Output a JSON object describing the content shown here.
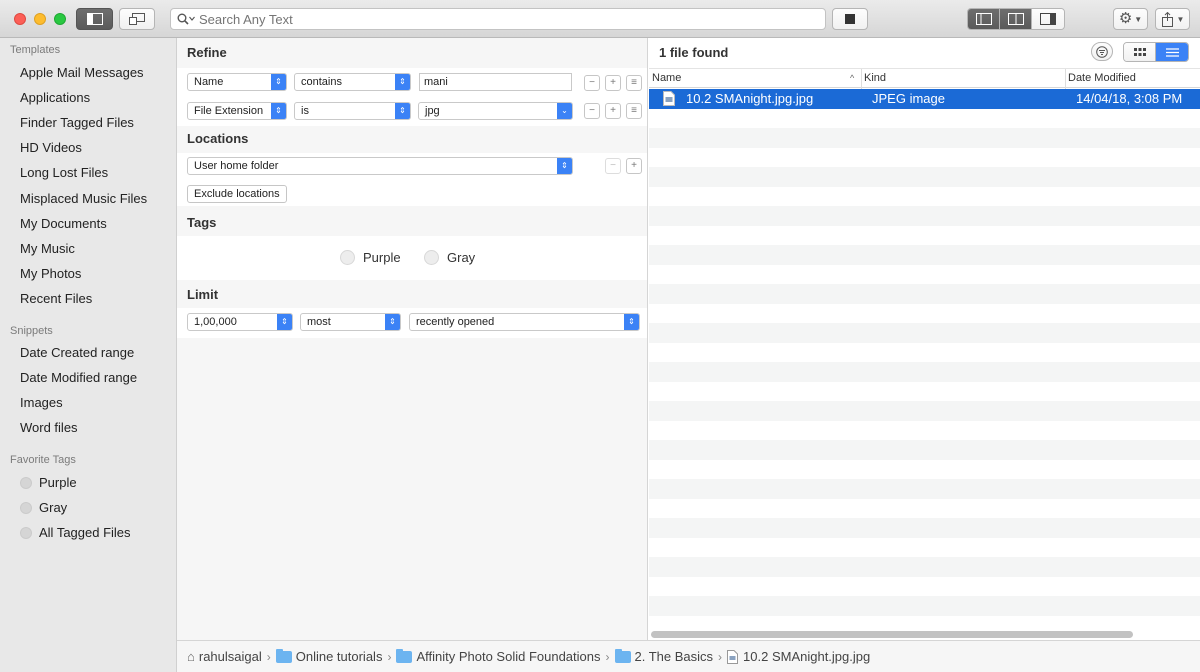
{
  "toolbar": {
    "search_placeholder": "Search Any Text"
  },
  "sidebar": {
    "templates_header": "Templates",
    "templates": [
      "Apple Mail Messages",
      "Applications",
      "Finder Tagged Files",
      "HD Videos",
      "Long Lost Files",
      "Misplaced Music Files",
      "My Documents",
      "My Music",
      "My Photos",
      "Recent Files"
    ],
    "snippets_header": "Snippets",
    "snippets": [
      "Date Created range",
      "Date Modified range",
      "Images",
      "Word files"
    ],
    "tags_header": "Favorite Tags",
    "tags": [
      "Purple",
      "Gray",
      "All Tagged Files"
    ]
  },
  "refine": {
    "title": "Refine",
    "rule1": {
      "attribute": "Name",
      "operator": "contains",
      "value": "mani"
    },
    "rule2": {
      "attribute": "File Extension",
      "operator": "is",
      "value": "jpg"
    }
  },
  "locations": {
    "title": "Locations",
    "selected": "User home folder",
    "exclude_label": "Exclude locations"
  },
  "tags_section": {
    "title": "Tags",
    "options": [
      "Purple",
      "Gray"
    ]
  },
  "limit": {
    "title": "Limit",
    "count": "1,00,000",
    "order": "most",
    "criterion": "recently opened"
  },
  "results": {
    "summary": "1 file found",
    "columns": [
      "Name",
      "Kind",
      "Date Modified"
    ],
    "files": [
      {
        "name": "10.2 SMAnight.jpg.jpg",
        "kind": "JPEG image",
        "modified": "14/04/18, 3:08 PM"
      }
    ]
  },
  "path": [
    "rahulsaigal",
    "Online tutorials",
    "Affinity Photo Solid Foundations",
    "2. The Basics",
    "10.2 SMAnight.jpg.jpg"
  ],
  "colors": {
    "accent": "#1b6ad6",
    "popup_blue": "#3b82f6"
  }
}
